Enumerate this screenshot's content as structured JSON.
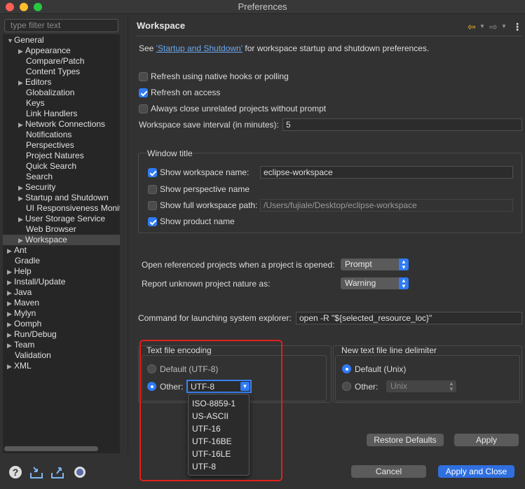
{
  "window": {
    "title": "Preferences"
  },
  "sidebar": {
    "filter_placeholder": "type filter text",
    "tree": [
      {
        "label": "General",
        "expanded": true
      },
      {
        "label": "Appearance"
      },
      {
        "label": "Compare/Patch"
      },
      {
        "label": "Content Types"
      },
      {
        "label": "Editors"
      },
      {
        "label": "Globalization"
      },
      {
        "label": "Keys"
      },
      {
        "label": "Link Handlers"
      },
      {
        "label": "Network Connections"
      },
      {
        "label": "Notifications"
      },
      {
        "label": "Perspectives"
      },
      {
        "label": "Project Natures"
      },
      {
        "label": "Quick Search"
      },
      {
        "label": "Search"
      },
      {
        "label": "Security"
      },
      {
        "label": "Startup and Shutdown"
      },
      {
        "label": "UI Responsiveness Monito"
      },
      {
        "label": "User Storage Service"
      },
      {
        "label": "Web Browser"
      },
      {
        "label": "Workspace",
        "selected": true
      },
      {
        "label": "Ant"
      },
      {
        "label": "Gradle"
      },
      {
        "label": "Help"
      },
      {
        "label": "Install/Update"
      },
      {
        "label": "Java"
      },
      {
        "label": "Maven"
      },
      {
        "label": "Mylyn"
      },
      {
        "label": "Oomph"
      },
      {
        "label": "Run/Debug"
      },
      {
        "label": "Team"
      },
      {
        "label": "Validation"
      },
      {
        "label": "XML"
      }
    ]
  },
  "page": {
    "title": "Workspace",
    "intro_prefix": "See ",
    "intro_link": "'Startup and Shutdown'",
    "intro_suffix": " for workspace startup and shutdown preferences.",
    "refresh_native": "Refresh using native hooks or polling",
    "refresh_access": "Refresh on access",
    "always_close": "Always close unrelated projects without prompt",
    "save_interval_label": "Workspace save interval (in minutes):",
    "save_interval_value": "5",
    "window_title_group": "Window title",
    "show_ws_name": "Show workspace name:",
    "ws_name_value": "eclipse-workspace",
    "show_perspective": "Show perspective name",
    "show_full_path": "Show full workspace path:",
    "full_path_value": "/Users/fujiale/Desktop/eclipse-workspace",
    "show_product": "Show product name",
    "open_ref_label": "Open referenced projects when a project is opened:",
    "open_ref_value": "Prompt",
    "report_label": "Report unknown project nature as:",
    "report_value": "Warning",
    "cmd_label": "Command for launching system explorer:",
    "cmd_value": "open -R \"${selected_resource_loc}\"",
    "encoding_group": "Text file encoding",
    "enc_default": "Default (UTF-8)",
    "enc_other": "Other:",
    "enc_other_value": "UTF-8",
    "delimiter_group": "New text file line delimiter",
    "delim_default": "Default (Unix)",
    "delim_other": "Other:",
    "delim_other_value": "Unix",
    "encoding_options": [
      "ISO-8859-1",
      "US-ASCII",
      "UTF-16",
      "UTF-16BE",
      "UTF-16LE",
      "UTF-8"
    ]
  },
  "buttons": {
    "restore": "Restore Defaults",
    "apply": "Apply",
    "cancel": "Cancel",
    "apply_close": "Apply and Close"
  },
  "colors": {
    "accent": "#2f7bf6",
    "highlight_box": "#e0201c",
    "link": "#6ba8f0"
  }
}
